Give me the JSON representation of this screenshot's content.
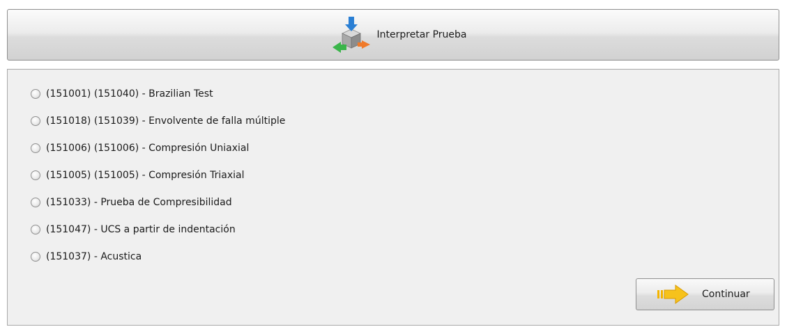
{
  "header": {
    "button_label": "Interpretar Prueba",
    "icon": "interpret-test-icon"
  },
  "options": [
    {
      "label": "(151001) (151040) - Brazilian Test",
      "selected": false
    },
    {
      "label": "(151018) (151039) - Envolvente de falla múltiple",
      "selected": false
    },
    {
      "label": "(151006) (151006) - Compresión Uniaxial",
      "selected": false
    },
    {
      "label": "(151005) (151005) - Compresión Triaxial",
      "selected": false
    },
    {
      "label": "(151033) - Prueba de Compresibilidad",
      "selected": false
    },
    {
      "label": "(151047) - UCS a partir de indentación",
      "selected": false
    },
    {
      "label": "(151037) - Acustica",
      "selected": false
    }
  ],
  "continue": {
    "label": "Continuar",
    "icon": "arrow-right-icon"
  },
  "colors": {
    "arrow_yellow": "#f4b400",
    "arrow_blue": "#2a7fd4",
    "arrow_green": "#3ab54a",
    "arrow_orange": "#f07a2a"
  }
}
